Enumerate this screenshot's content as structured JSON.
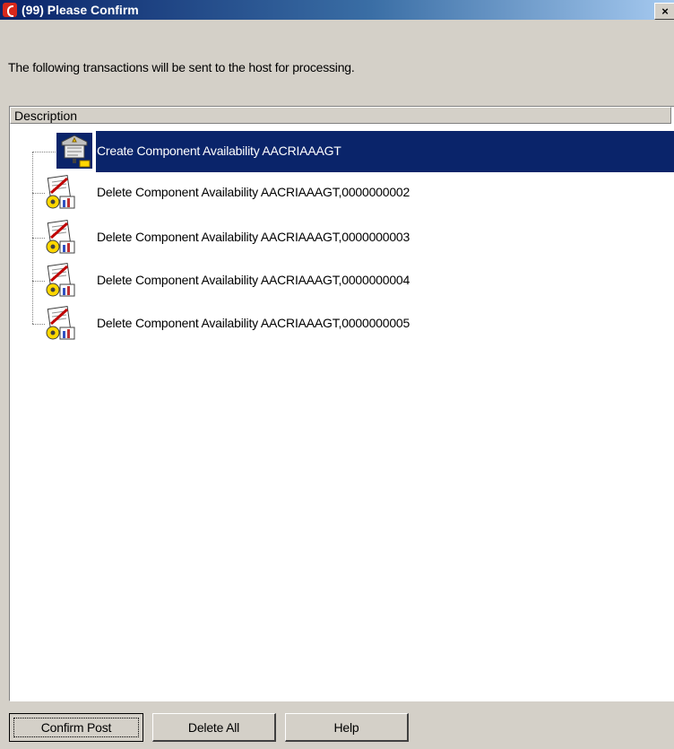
{
  "window": {
    "title": "(99) Please Confirm",
    "close_label": "×"
  },
  "message": "The following transactions will be sent to the host for processing.",
  "list": {
    "column_header": "Description",
    "items": [
      {
        "label": "Create Component Availability  AACRIAAAGT",
        "icon": "create-transaction-icon",
        "selected": true
      },
      {
        "label": "Delete Component Availability  AACRIAAAGT,0000000002",
        "icon": "delete-transaction-icon",
        "selected": false
      },
      {
        "label": "Delete Component Availability  AACRIAAAGT,0000000003",
        "icon": "delete-transaction-icon",
        "selected": false
      },
      {
        "label": "Delete Component Availability  AACRIAAAGT,0000000004",
        "icon": "delete-transaction-icon",
        "selected": false
      },
      {
        "label": "Delete Component Availability  AACRIAAAGT,0000000005",
        "icon": "delete-transaction-icon",
        "selected": false
      }
    ]
  },
  "buttons": {
    "confirm_post": "Confirm Post",
    "delete_all": "Delete All",
    "help": "Help"
  },
  "colors": {
    "selection": "#0a246a",
    "face": "#d4d0c8"
  }
}
